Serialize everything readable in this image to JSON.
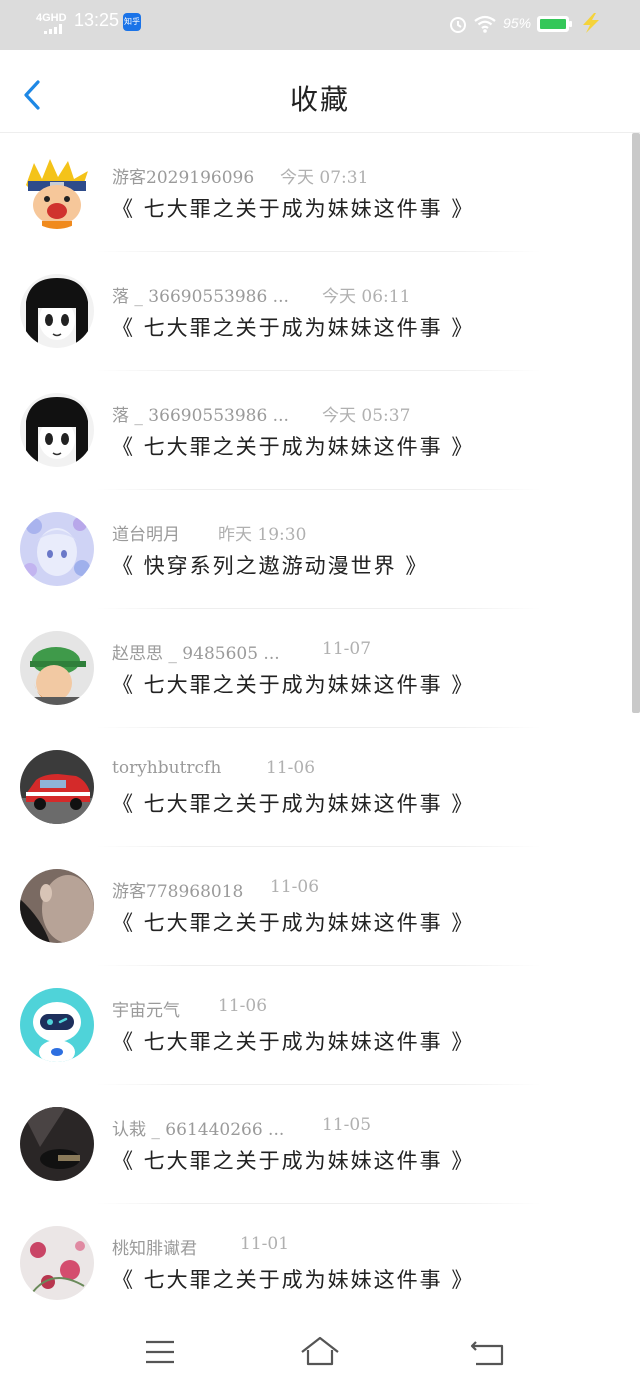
{
  "status_bar": {
    "network": "4GHD",
    "time": "13:25",
    "app_badge": "知乎",
    "battery": "95%",
    "battery_fill_fraction": 0.95,
    "icons": [
      "signal-icon",
      "alarm-icon",
      "wifi-icon",
      "battery-icon",
      "charging-bolt-icon"
    ]
  },
  "header": {
    "title": "收藏",
    "back_icon": "chevron-left-icon",
    "accent_color": "#1e88e5"
  },
  "favorites": [
    {
      "user": "游客2029196096",
      "time": "今天 07:31",
      "book": "《 七大罪之关于成为妹妹这件事 》",
      "avatar": "avatar-ninja"
    },
    {
      "user": "落 _ 36690553986 ...",
      "time": "今天 06:11",
      "book": "《 七大罪之关于成为妹妹这件事 》",
      "avatar": "avatar-manga-girl"
    },
    {
      "user": "落 _ 36690553986 ...",
      "time": "今天 05:37",
      "book": "《 七大罪之关于成为妹妹这件事 》",
      "avatar": "avatar-manga-girl"
    },
    {
      "user": "道台明月",
      "time": "昨天 19:30",
      "book": "《 快穿系列之遨游动漫世界 》",
      "avatar": "avatar-floral-anime"
    },
    {
      "user": "赵思思 _ 9485605 ...",
      "time": "11-07",
      "book": "《 七大罪之关于成为妹妹这件事 》",
      "avatar": "avatar-cap"
    },
    {
      "user": "toryhbutrcfh",
      "time": "11-06",
      "book": "《 七大罪之关于成为妹妹这件事 》",
      "avatar": "avatar-rally-car"
    },
    {
      "user": "游客778968018",
      "time": "11-06",
      "book": "《 七大罪之关于成为妹妹这件事 》",
      "avatar": "avatar-photo-dark"
    },
    {
      "user": "宇宙元气",
      "time": "11-06",
      "book": "《 七大罪之关于成为妹妹这件事 》",
      "avatar": "avatar-robot"
    },
    {
      "user": "认栽 _ 661440266 ...",
      "time": "11-05",
      "book": "《 七大罪之关于成为妹妹这件事 》",
      "avatar": "avatar-dark-photo"
    },
    {
      "user": "桃知腓谳君",
      "time": "11-01",
      "book": "《 七大罪之关于成为妹妹这件事 》",
      "avatar": "avatar-flowers"
    }
  ],
  "navbar": {
    "icons": [
      "menu-icon",
      "home-icon",
      "back-icon"
    ]
  }
}
